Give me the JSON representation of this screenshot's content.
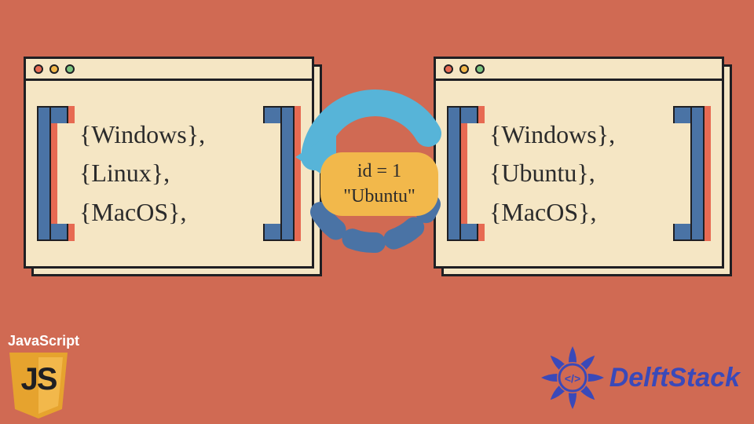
{
  "colors": {
    "background": "#d06a53",
    "panel": "#f5e6c4",
    "bracket_main": "#4a73a5",
    "bracket_shadow": "#e76a52",
    "accent_pill": "#f2b84b",
    "arrow_solid": "#57b4d8",
    "arrow_dash": "#4a73a5",
    "logo_delft": "#3a49b9",
    "js_yellow": "#f2b84b"
  },
  "left_window": {
    "items": [
      "{Windows},",
      "{Linux},",
      "{MacOS},"
    ]
  },
  "right_window": {
    "items": [
      "{Windows},",
      "{Ubuntu},",
      "{MacOS},"
    ]
  },
  "transform": {
    "line1": "id = 1",
    "line2": "\"Ubuntu\""
  },
  "js_logo": {
    "label": "JavaScript",
    "text": "JS"
  },
  "delftstack": {
    "text": "DelftStack"
  },
  "traffic_icons": [
    "close-icon",
    "minimize-icon",
    "zoom-icon"
  ]
}
